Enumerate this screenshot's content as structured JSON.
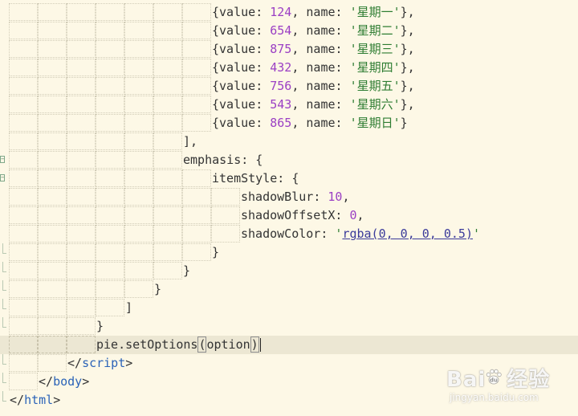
{
  "editor": {
    "lines": [
      {
        "row": 1,
        "indent": 7,
        "tokens": [
          [
            "punc",
            "{"
          ],
          [
            "key",
            "value"
          ],
          [
            "punc",
            ": "
          ],
          [
            "num",
            "124"
          ],
          [
            "punc",
            ", "
          ],
          [
            "key",
            "name"
          ],
          [
            "punc",
            ": "
          ],
          [
            "str",
            "'星期一'"
          ],
          [
            "punc",
            "},"
          ]
        ]
      },
      {
        "row": 2,
        "indent": 7,
        "tokens": [
          [
            "punc",
            "{"
          ],
          [
            "key",
            "value"
          ],
          [
            "punc",
            ": "
          ],
          [
            "num",
            "654"
          ],
          [
            "punc",
            ", "
          ],
          [
            "key",
            "name"
          ],
          [
            "punc",
            ": "
          ],
          [
            "str",
            "'星期二'"
          ],
          [
            "punc",
            "},"
          ]
        ]
      },
      {
        "row": 3,
        "indent": 7,
        "tokens": [
          [
            "punc",
            "{"
          ],
          [
            "key",
            "value"
          ],
          [
            "punc",
            ": "
          ],
          [
            "num",
            "875"
          ],
          [
            "punc",
            ", "
          ],
          [
            "key",
            "name"
          ],
          [
            "punc",
            ": "
          ],
          [
            "str",
            "'星期三'"
          ],
          [
            "punc",
            "},"
          ]
        ]
      },
      {
        "row": 4,
        "indent": 7,
        "tokens": [
          [
            "punc",
            "{"
          ],
          [
            "key",
            "value"
          ],
          [
            "punc",
            ": "
          ],
          [
            "num",
            "432"
          ],
          [
            "punc",
            ", "
          ],
          [
            "key",
            "name"
          ],
          [
            "punc",
            ": "
          ],
          [
            "str",
            "'星期四'"
          ],
          [
            "punc",
            "},"
          ]
        ]
      },
      {
        "row": 5,
        "indent": 7,
        "tokens": [
          [
            "punc",
            "{"
          ],
          [
            "key",
            "value"
          ],
          [
            "punc",
            ": "
          ],
          [
            "num",
            "756"
          ],
          [
            "punc",
            ", "
          ],
          [
            "key",
            "name"
          ],
          [
            "punc",
            ": "
          ],
          [
            "str",
            "'星期五'"
          ],
          [
            "punc",
            "},"
          ]
        ]
      },
      {
        "row": 6,
        "indent": 7,
        "tokens": [
          [
            "punc",
            "{"
          ],
          [
            "key",
            "value"
          ],
          [
            "punc",
            ": "
          ],
          [
            "num",
            "543"
          ],
          [
            "punc",
            ", "
          ],
          [
            "key",
            "name"
          ],
          [
            "punc",
            ": "
          ],
          [
            "str",
            "'星期六'"
          ],
          [
            "punc",
            "},"
          ]
        ]
      },
      {
        "row": 7,
        "indent": 7,
        "tokens": [
          [
            "punc",
            "{"
          ],
          [
            "key",
            "value"
          ],
          [
            "punc",
            ": "
          ],
          [
            "num",
            "865"
          ],
          [
            "punc",
            ", "
          ],
          [
            "key",
            "name"
          ],
          [
            "punc",
            ": "
          ],
          [
            "str",
            "'星期日'"
          ],
          [
            "punc",
            "}"
          ]
        ]
      },
      {
        "row": 8,
        "indent": 6,
        "tokens": [
          [
            "punc",
            "],"
          ]
        ]
      },
      {
        "row": 9,
        "indent": 6,
        "fold": "open",
        "tokens": [
          [
            "key",
            "emphasis"
          ],
          [
            "punc",
            ": {"
          ]
        ]
      },
      {
        "row": 10,
        "indent": 7,
        "fold": "open",
        "tokens": [
          [
            "key",
            "itemStyle"
          ],
          [
            "punc",
            ": {"
          ]
        ]
      },
      {
        "row": 11,
        "indent": 8,
        "tokens": [
          [
            "key",
            "shadowBlur"
          ],
          [
            "punc",
            ": "
          ],
          [
            "num",
            "10"
          ],
          [
            "punc",
            ","
          ]
        ]
      },
      {
        "row": 12,
        "indent": 8,
        "tokens": [
          [
            "key",
            "shadowOffsetX"
          ],
          [
            "punc",
            ": "
          ],
          [
            "num",
            "0"
          ],
          [
            "punc",
            ","
          ]
        ]
      },
      {
        "row": 13,
        "indent": 8,
        "tokens": [
          [
            "key",
            "shadowColor"
          ],
          [
            "punc",
            ": "
          ],
          [
            "str",
            "'"
          ],
          [
            "strlink",
            "rgba(0, 0, 0, 0.5)"
          ],
          [
            "str",
            "'"
          ]
        ]
      },
      {
        "row": 14,
        "indent": 7,
        "fold": "end",
        "tokens": [
          [
            "punc",
            "}"
          ]
        ]
      },
      {
        "row": 15,
        "indent": 6,
        "fold": "end",
        "tokens": [
          [
            "punc",
            "}"
          ]
        ]
      },
      {
        "row": 16,
        "indent": 5,
        "fold": "end",
        "tokens": [
          [
            "punc",
            "}"
          ]
        ]
      },
      {
        "row": 17,
        "indent": 4,
        "fold": "end",
        "tokens": [
          [
            "punc",
            "]"
          ]
        ]
      },
      {
        "row": 18,
        "indent": 3,
        "fold": "end",
        "tokens": [
          [
            "punc",
            "}"
          ]
        ]
      },
      {
        "row": 19,
        "indent": 3,
        "current": true,
        "tokens": [
          [
            "ident",
            "pie.setOptions"
          ],
          [
            "punc",
            "("
          ],
          [
            "ident",
            "option"
          ],
          [
            "punc",
            ")"
          ]
        ]
      },
      {
        "row": 20,
        "indent": 2,
        "fold": "end",
        "tokens": [
          [
            "punc",
            "</"
          ],
          [
            "tag",
            "script"
          ],
          [
            "punc",
            ">"
          ]
        ]
      },
      {
        "row": 21,
        "indent": 1,
        "fold": "end",
        "tokens": [
          [
            "punc",
            "</"
          ],
          [
            "tag",
            "body"
          ],
          [
            "punc",
            ">"
          ]
        ]
      },
      {
        "row": 22,
        "indent": 0,
        "fold": "end",
        "tokens": [
          [
            "punc",
            "</"
          ],
          [
            "tag",
            "html"
          ],
          [
            "punc",
            ">"
          ]
        ]
      }
    ]
  },
  "watermark": {
    "brand_left": "Bai",
    "brand_right": "经验",
    "paw_icon": "baidu-paw-icon",
    "url": "jingyan.baidu.com"
  },
  "colors": {
    "background": "#fdf8e6",
    "current_line": "#ece7d3",
    "number": "#9b3fc4",
    "string": "#2e7d32",
    "tag": "#2b63b8"
  }
}
